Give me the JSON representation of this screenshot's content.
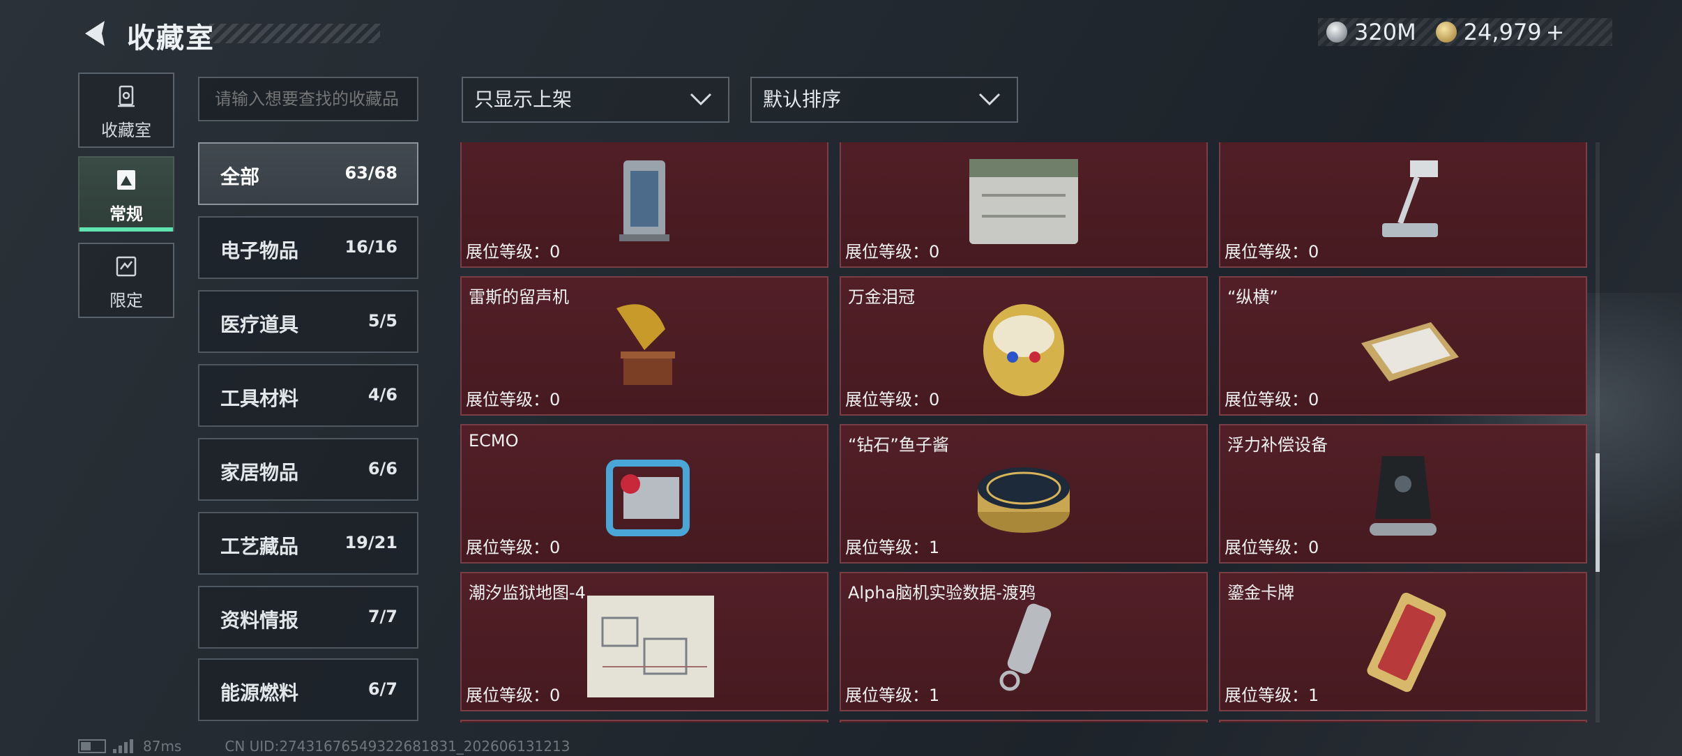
{
  "header": {
    "title": "收藏室",
    "currency": [
      {
        "icon": "silver-coin-icon",
        "value": "320M"
      },
      {
        "icon": "gold-coin-icon",
        "value": "24,979"
      }
    ],
    "plus": "+"
  },
  "nav": [
    {
      "label": "收藏室",
      "icon": "collection-room-icon",
      "active": false
    },
    {
      "label": "常规",
      "icon": "regular-icon",
      "active": true
    },
    {
      "label": "限定",
      "icon": "limited-icon",
      "active": false
    }
  ],
  "search": {
    "placeholder": "请输入想要查找的收藏品"
  },
  "filters": {
    "show": "只显示上架",
    "sort": "默认排序"
  },
  "categories": [
    {
      "name": "全部",
      "count": "63/68",
      "active": true
    },
    {
      "name": "电子物品",
      "count": "16/16"
    },
    {
      "name": "医疗道具",
      "count": "5/5"
    },
    {
      "name": "工具材料",
      "count": "4/6"
    },
    {
      "name": "家居物品",
      "count": "6/6"
    },
    {
      "name": "工艺藏品",
      "count": "19/21"
    },
    {
      "name": "资料情报",
      "count": "7/7"
    },
    {
      "name": "能源燃料",
      "count": "6/7"
    }
  ],
  "level_prefix": "展位等级：",
  "items": [
    {
      "name": "",
      "level": "展位等级：0"
    },
    {
      "name": "",
      "level": "展位等级：0"
    },
    {
      "name": "",
      "level": "展位等级：0"
    },
    {
      "name": "雷斯的留声机",
      "level": "展位等级：0"
    },
    {
      "name": "万金泪冠",
      "level": "展位等级：0"
    },
    {
      "name": "“纵横”",
      "level": "展位等级：0"
    },
    {
      "name": "ECMO",
      "level": "展位等级：0"
    },
    {
      "name": "“钻石”鱼子酱",
      "level": "展位等级：1"
    },
    {
      "name": "浮力补偿设备",
      "level": "展位等级：0"
    },
    {
      "name": "潮汐监狱地图-4",
      "level": "展位等级：0"
    },
    {
      "name": "Alpha脑机实验数据-渡鸦",
      "level": "展位等级：1"
    },
    {
      "name": "鎏金卡牌",
      "level": "展位等级：1"
    }
  ],
  "footer": {
    "ping": "87ms",
    "uid": "CN UID:27431676549322681831_202606131213"
  },
  "colors": {
    "accent": "#5fe3b0",
    "card_bg": "#4a1d23"
  }
}
